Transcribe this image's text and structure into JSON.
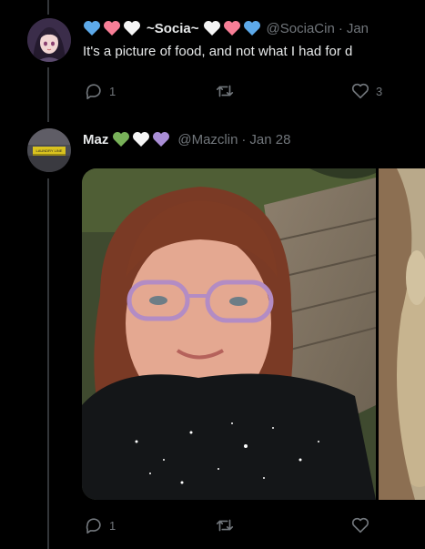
{
  "tweet1": {
    "display_name": "~Socia~",
    "handle": "@SociaCin",
    "dot": "·",
    "time": "Jan",
    "text": "It's a picture of food, and not what I had for d",
    "reply_count": "1",
    "like_count": "3"
  },
  "tweet2": {
    "display_name": "Maz",
    "handle": "@Mazclin",
    "dot": "·",
    "time": "Jan 28",
    "reply_count": "1",
    "avatar_banner": "LAUNDRY LINE"
  },
  "colors": {
    "background": "#000000",
    "text": "#e7e9ea",
    "muted": "#71767b",
    "heart_blue": "#5da9e9",
    "heart_pink": "#f77e96",
    "heart_white": "#f5f5f5",
    "heart_green": "#78b159",
    "heart_purple": "#aa8ed6"
  }
}
